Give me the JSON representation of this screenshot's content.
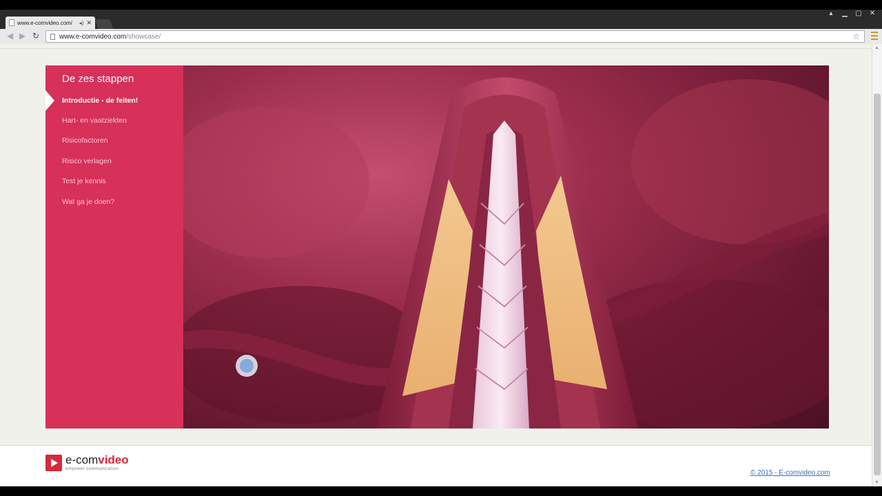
{
  "browser": {
    "tab_title": "www.e-comvideo.com/",
    "url_host": "www.e-comvideo.com",
    "url_path": "/showcase/",
    "icons": {
      "back": "back-arrow-icon",
      "forward": "forward-arrow-icon",
      "reload": "reload-icon",
      "bookmark": "star-icon",
      "menu": "hamburger-menu-icon"
    }
  },
  "sidebar": {
    "title": "De zes stappen",
    "steps": [
      {
        "label": "Introductie - de feiten!",
        "active": true
      },
      {
        "label": "Hart- en vaatziekten",
        "active": false
      },
      {
        "label": "Risicofactoren",
        "active": false
      },
      {
        "label": "Risico verlagen",
        "active": false
      },
      {
        "label": "Test je kennis",
        "active": false
      },
      {
        "label": "Wat ga je doen?",
        "active": false
      }
    ]
  },
  "footer": {
    "logo_prefix": "e-com",
    "logo_suffix": "video",
    "logo_tagline": "empower communication",
    "copyright": "© 2015 - E-comvideo.com"
  },
  "colors": {
    "sidebar_bg": "#d73059",
    "brand_red": "#d62a3b",
    "link": "#3a6fb5"
  }
}
